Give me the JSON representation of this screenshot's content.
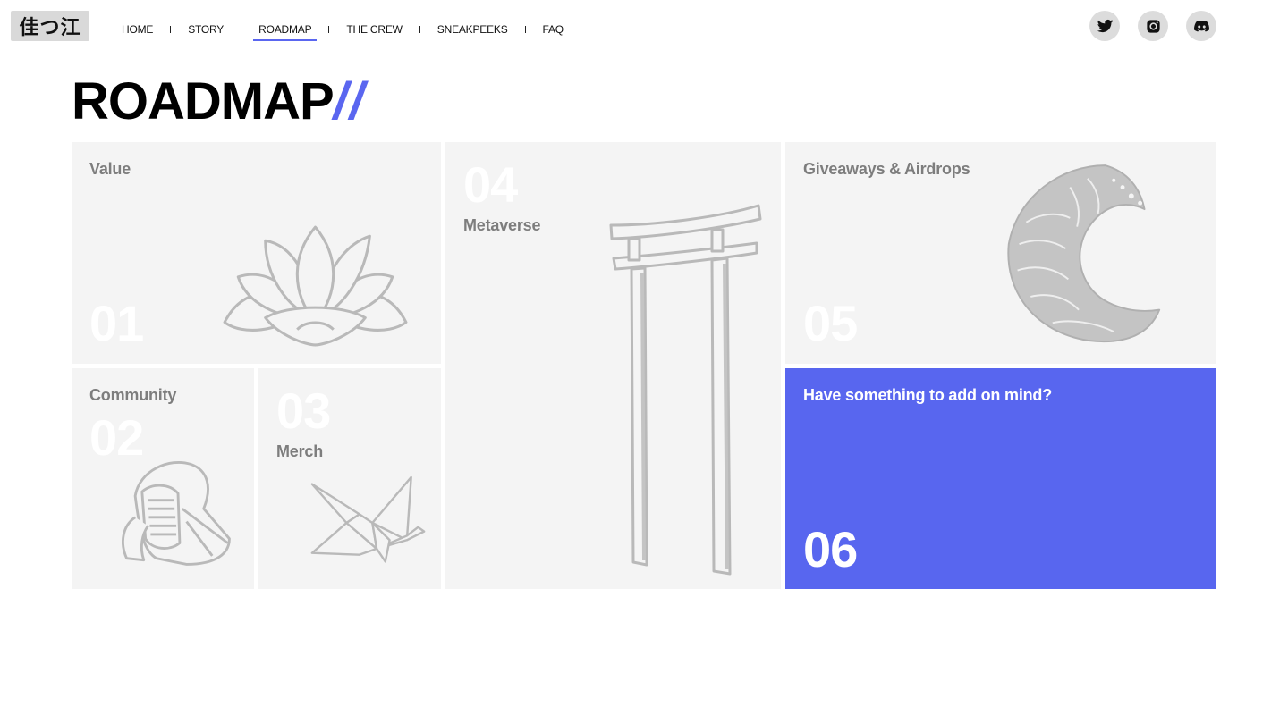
{
  "header": {
    "logo_text": "佳つ江",
    "nav": [
      {
        "label": "HOME"
      },
      {
        "label": "STORY"
      },
      {
        "label": "ROADMAP",
        "active": true
      },
      {
        "label": "THE CREW"
      },
      {
        "label": "SNEAKPEEKS"
      },
      {
        "label": "FAQ"
      }
    ],
    "social": [
      {
        "icon": "twitter-icon"
      },
      {
        "icon": "instagram-icon"
      },
      {
        "icon": "discord-icon"
      }
    ]
  },
  "page": {
    "title": "ROADMAP",
    "title_accent": "//",
    "accent_color": "#5a66f0"
  },
  "roadmap": {
    "cards": [
      {
        "number": "01",
        "label": "Value",
        "illustration": "lotus-illustration"
      },
      {
        "number": "02",
        "label": "Community",
        "illustration": "kendo-helmet-illustration"
      },
      {
        "number": "03",
        "label": "Merch",
        "illustration": "paper-crane-illustration"
      },
      {
        "number": "04",
        "label": "Metaverse",
        "illustration": "torii-gate-illustration"
      },
      {
        "number": "05",
        "label": "Giveaways & Airdrops",
        "illustration": "great-wave-illustration"
      },
      {
        "number": "06",
        "label": "Have something to add on mind?",
        "color": "#5866ef"
      }
    ]
  }
}
